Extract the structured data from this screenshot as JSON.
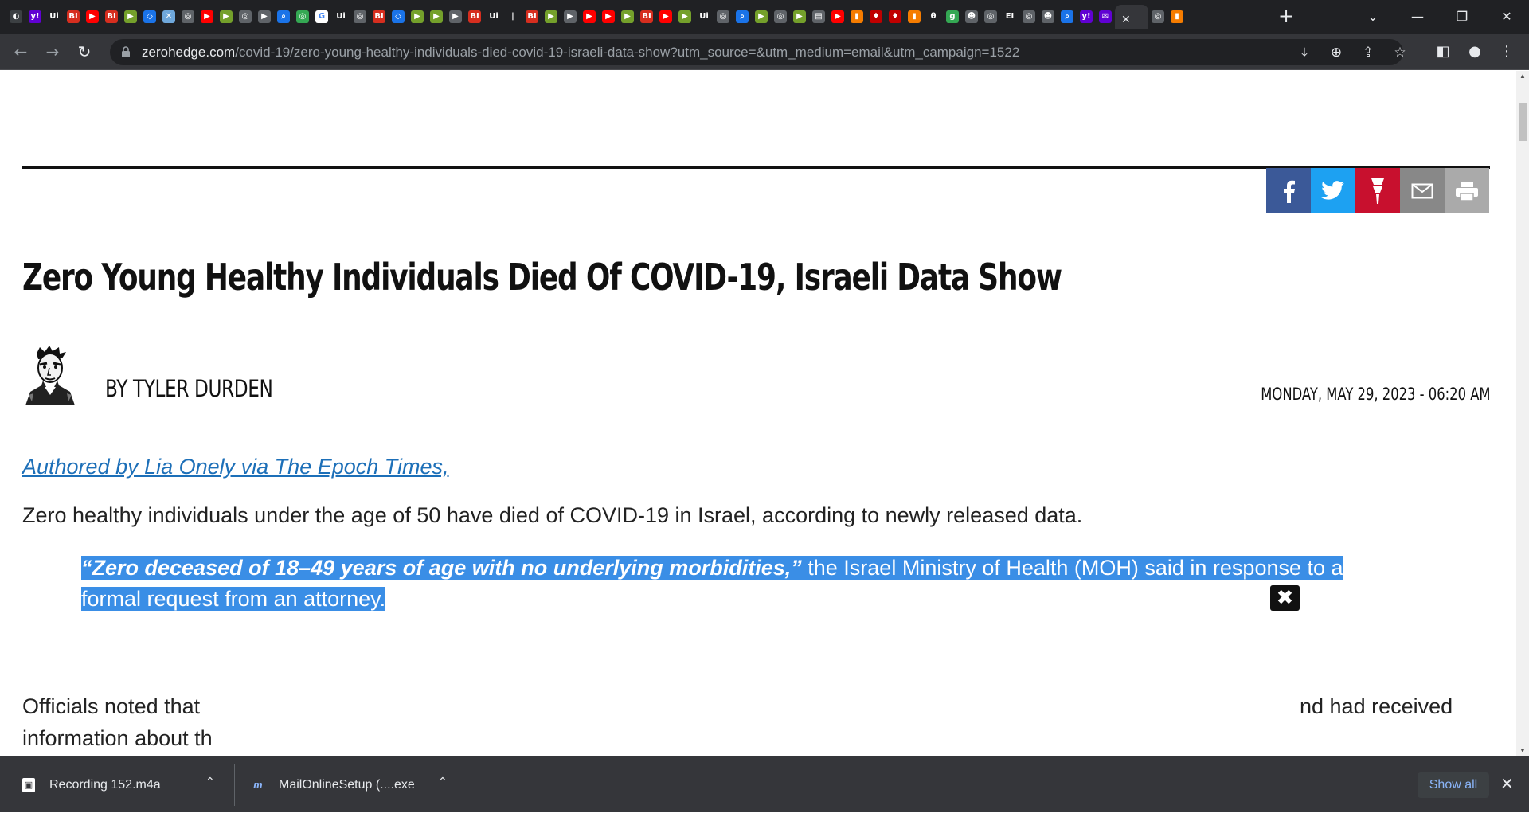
{
  "browser": {
    "tabs": [
      {
        "icon": "generic-site-icon",
        "glyph": "◐",
        "bg": "#3c4043"
      },
      {
        "icon": "yahoo-icon",
        "glyph": "y!",
        "bg": "#6001d2"
      },
      {
        "icon": "ui-site-icon",
        "glyph": "Ui",
        "bg": "#202124"
      },
      {
        "icon": "bi-icon",
        "glyph": "BI",
        "bg": "#d62e1f"
      },
      {
        "icon": "youtube-icon",
        "glyph": "▶",
        "bg": "#ff0000"
      },
      {
        "icon": "bi-icon",
        "glyph": "BI",
        "bg": "#d62e1f"
      },
      {
        "icon": "rumble-icon",
        "glyph": "▶",
        "bg": "#74a02b"
      },
      {
        "icon": "shield-icon",
        "glyph": "◇",
        "bg": "#1a73e8"
      },
      {
        "icon": "map-icon",
        "glyph": "✕",
        "bg": "#6fa8dc"
      },
      {
        "icon": "globe-icon",
        "glyph": "◎",
        "bg": "#5f6368"
      },
      {
        "icon": "youtube-icon",
        "glyph": "▶",
        "bg": "#ff0000"
      },
      {
        "icon": "rumble-icon",
        "glyph": "▶",
        "bg": "#74a02b"
      },
      {
        "icon": "globe-icon",
        "glyph": "◎",
        "bg": "#5f6368"
      },
      {
        "icon": "play-icon",
        "glyph": "▶",
        "bg": "#5f6368"
      },
      {
        "icon": "search-icon",
        "glyph": "⌕",
        "bg": "#1a73e8"
      },
      {
        "icon": "globe-icon",
        "glyph": "◎",
        "bg": "#34a853"
      },
      {
        "icon": "google-icon",
        "glyph": "G",
        "bg": "#ffffff"
      },
      {
        "icon": "ui-site-icon",
        "glyph": "Ui",
        "bg": "#202124"
      },
      {
        "icon": "globe-icon",
        "glyph": "◎",
        "bg": "#5f6368"
      },
      {
        "icon": "bi-icon",
        "glyph": "BI",
        "bg": "#d62e1f"
      },
      {
        "icon": "shield-icon",
        "glyph": "◇",
        "bg": "#1a73e8"
      },
      {
        "icon": "rumble-icon",
        "glyph": "▶",
        "bg": "#74a02b"
      },
      {
        "icon": "rumble-icon",
        "glyph": "▶",
        "bg": "#74a02b"
      },
      {
        "icon": "play-icon",
        "glyph": "▶",
        "bg": "#5f6368"
      },
      {
        "icon": "bi-icon",
        "glyph": "BI",
        "bg": "#d62e1f"
      },
      {
        "icon": "ui-site-icon",
        "glyph": "Ui",
        "bg": "#202124"
      },
      {
        "icon": "pipe-icon",
        "glyph": "|",
        "bg": "#202124"
      },
      {
        "icon": "bi-icon",
        "glyph": "BI",
        "bg": "#d62e1f"
      },
      {
        "icon": "rumble-icon",
        "glyph": "▶",
        "bg": "#74a02b"
      },
      {
        "icon": "play-icon",
        "glyph": "▶",
        "bg": "#5f6368"
      },
      {
        "icon": "youtube-icon",
        "glyph": "▶",
        "bg": "#ff0000"
      },
      {
        "icon": "youtube-icon",
        "glyph": "▶",
        "bg": "#ff0000"
      },
      {
        "icon": "rumble-icon",
        "glyph": "▶",
        "bg": "#74a02b"
      },
      {
        "icon": "bi-icon",
        "glyph": "BI",
        "bg": "#d62e1f"
      },
      {
        "icon": "youtube-icon",
        "glyph": "▶",
        "bg": "#ff0000"
      },
      {
        "icon": "rumble-icon",
        "glyph": "▶",
        "bg": "#74a02b"
      },
      {
        "icon": "ui-site-icon",
        "glyph": "Ui",
        "bg": "#202124"
      },
      {
        "icon": "globe-icon",
        "glyph": "◎",
        "bg": "#5f6368"
      },
      {
        "icon": "search-icon",
        "glyph": "⌕",
        "bg": "#1a73e8"
      },
      {
        "icon": "rumble-icon",
        "glyph": "▶",
        "bg": "#74a02b"
      },
      {
        "icon": "globe-icon",
        "glyph": "◎",
        "bg": "#5f6368"
      },
      {
        "icon": "rumble-icon",
        "glyph": "▶",
        "bg": "#74a02b"
      },
      {
        "icon": "news-icon",
        "glyph": "▤",
        "bg": "#5f6368"
      },
      {
        "icon": "youtube-icon",
        "glyph": "▶",
        "bg": "#ff0000"
      },
      {
        "icon": "bookmark-icon",
        "glyph": "▮",
        "bg": "#f57c00"
      },
      {
        "icon": "torch-icon",
        "glyph": "♦",
        "bg": "#c00000"
      },
      {
        "icon": "torch-icon",
        "glyph": "♦",
        "bg": "#c00000"
      },
      {
        "icon": "bookmark-icon",
        "glyph": "▮",
        "bg": "#f57c00"
      },
      {
        "icon": "theta-icon",
        "glyph": "θ",
        "bg": "#202124"
      },
      {
        "icon": "g-icon",
        "glyph": "g",
        "bg": "#34a853"
      },
      {
        "icon": "person-icon",
        "glyph": "☻",
        "bg": "#5f6368"
      },
      {
        "icon": "globe-icon",
        "glyph": "◎",
        "bg": "#5f6368"
      },
      {
        "icon": "ei-icon",
        "glyph": "EI",
        "bg": "#202124"
      },
      {
        "icon": "globe-icon",
        "glyph": "◎",
        "bg": "#5f6368"
      },
      {
        "icon": "person-icon",
        "glyph": "☻",
        "bg": "#5f6368"
      },
      {
        "icon": "search-icon",
        "glyph": "⌕",
        "bg": "#1a73e8"
      },
      {
        "icon": "yahoo-icon",
        "glyph": "y!",
        "bg": "#6001d2"
      },
      {
        "icon": "yahoo-mail-icon",
        "glyph": "✉",
        "bg": "#6001d2"
      }
    ],
    "active_tab": {
      "icon": "zerohedge-icon",
      "glyph": "✕"
    },
    "after_tabs": [
      {
        "icon": "globe-icon",
        "glyph": "◎",
        "bg": "#5f6368"
      },
      {
        "icon": "bookmark-icon",
        "glyph": "▮",
        "bg": "#f57c00"
      }
    ],
    "url_host": "zerohedge.com",
    "url_path": "/covid-19/zero-young-healthy-individuals-died-covid-19-israeli-data-show?utm_source=&utm_medium=email&utm_campaign=1522"
  },
  "article": {
    "share_colors": {
      "facebook": "#3b5998",
      "twitter": "#1da1f2",
      "gab": "#c8102e",
      "email": "#888888",
      "print": "#aaaaaa"
    },
    "title": "Zero Young Healthy Individuals Died Of COVID-19, Israeli Data Show",
    "byline": "BY TYLER DURDEN",
    "date": "MONDAY, MAY 29, 2023 - 06:20 AM",
    "author_link": "Authored by Lia Onely via The Epoch Times,",
    "para1": "Zero healthy individuals under the age of 50 have died of COVID-19 in Israel, according to newly released data.",
    "quote_bold": "“Zero deceased of 18–49 years of age with no underlying morbidities,”",
    "quote_rest": " the Israel Ministry of Health (MOH) said in response to a formal request from an attorney.",
    "quote_highlight_color": "#3a8ee6",
    "para2_left": "Officials noted that",
    "para2_right": "nd had received",
    "para3": "information about th"
  },
  "downloads": {
    "items": [
      {
        "name": "Recording 152.m4a",
        "icon": "audio-file-icon"
      },
      {
        "name": "MailOnlineSetup (....exe",
        "icon": "mailonline-icon"
      }
    ],
    "show_all": "Show all"
  }
}
